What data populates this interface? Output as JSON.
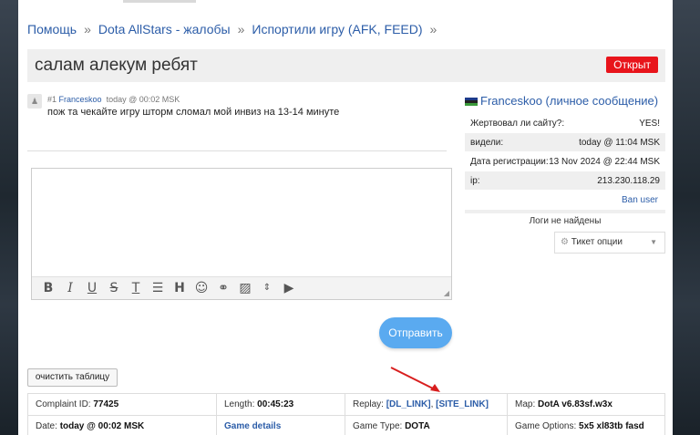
{
  "breadcrumb": {
    "items": [
      "Помощь",
      "Dota AllStars - жалобы",
      "Испортили игру (AFK, FEED)"
    ],
    "separator": "»"
  },
  "ticket": {
    "title": "салам алекум ребят",
    "status": "Открыт"
  },
  "post": {
    "number": "#1",
    "author": "Franceskoo",
    "time": "today @ 00:02 MSK",
    "message": "пож та чекайте игру шторм сломал мой инвиз на 13-14 минуте"
  },
  "editor": {
    "toolbar": [
      "bold-icon",
      "italic-icon",
      "underline-icon",
      "strikethrough-icon",
      "clear-format-icon",
      "list-icon",
      "heading-icon",
      "emoji-icon",
      "link-icon",
      "image-icon",
      "collapse-icon",
      "video-icon"
    ]
  },
  "send_label": "Отправить",
  "sidebar": {
    "username": "Franceskoo",
    "pm_label": "(личное сообщение)",
    "rows": [
      {
        "label": "Жертвовал ли сайту?:",
        "value": "YES!"
      },
      {
        "label": "видели:",
        "value": "today @ 11:04 MSK"
      },
      {
        "label": "Дата регистрации:",
        "value": "13 Nov 2024 @ 22:44 MSK"
      },
      {
        "label": "ip:",
        "value": "213.230.118.29"
      }
    ],
    "ban_label": "Ban user",
    "logs_label": "Логи не найдены",
    "ticket_options_label": "Тикет опции"
  },
  "clear_label": "очистить таблицу",
  "details": {
    "complaint_id_label": "Complaint ID:",
    "complaint_id": "77425",
    "length_label": "Length:",
    "length": "00:45:23",
    "replay_label": "Replay:",
    "replay_dl": "[DL_LINK]",
    "replay_site": "[SITE_LINK]",
    "map_label": "Map:",
    "map": "DotA v6.83sf.w3x",
    "date_label": "Date:",
    "date": "today @ 00:02 MSK",
    "game_details": "Game details",
    "game_type_label": "Game Type:",
    "game_type": "DOTA",
    "game_options_label": "Game Options:",
    "game_options": "5x5 xl83tb fasd"
  },
  "colors": {
    "link": "#2c5da8",
    "status_red": "#e8141b",
    "send_blue": "#5aaaf0",
    "arrow_red": "#d81e1e"
  }
}
